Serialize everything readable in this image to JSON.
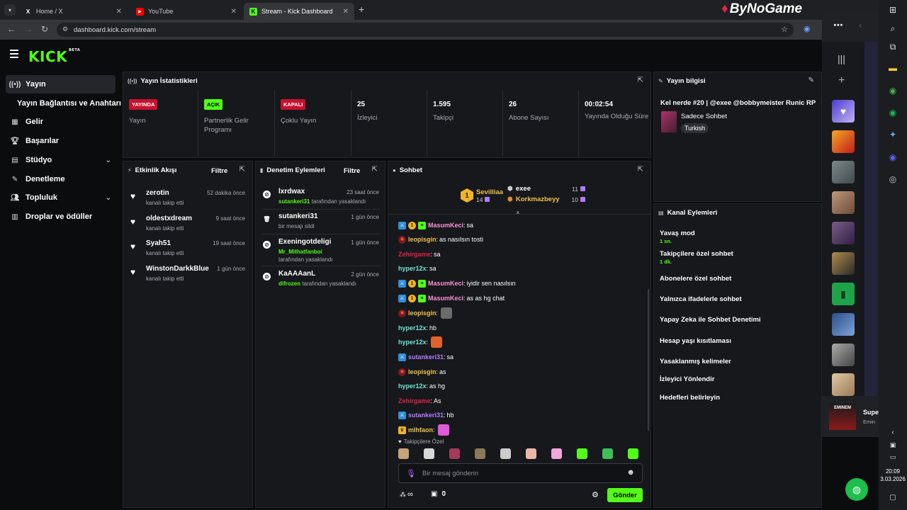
{
  "browser": {
    "tabs": [
      {
        "title": "Home / X",
        "icon": "x-logo-icon"
      },
      {
        "title": "YouTube",
        "icon": "youtube-icon"
      },
      {
        "title": "Stream - Kick Dashboard",
        "icon": "kick-icon"
      }
    ],
    "new_tab": "+",
    "url": "dashboard.kick.com/stream",
    "watermark": "ByNoGame"
  },
  "brand": {
    "logo": "KICK",
    "beta": "BETA"
  },
  "sidebar": {
    "items": [
      {
        "label": "Yayın",
        "icon": "broadcast-icon"
      },
      {
        "label": "Yayın Bağlantısı ve Anahtarı",
        "icon": ""
      },
      {
        "label": "Gelir",
        "icon": "revenue-icon"
      },
      {
        "label": "Başarılar",
        "icon": "trophy-icon"
      },
      {
        "label": "Stüdyo",
        "icon": "studio-icon"
      },
      {
        "label": "Denetleme",
        "icon": "wrench-icon"
      },
      {
        "label": "Topluluk",
        "icon": "community-icon"
      },
      {
        "label": "Droplar ve ödüller",
        "icon": "drops-icon"
      }
    ]
  },
  "stats": {
    "title": "Yayın İstatistikleri",
    "items": [
      {
        "badge": "YAYINDA",
        "label": "Yayın"
      },
      {
        "badge": "AÇIK",
        "label": "Partnerlik Gelir Programı"
      },
      {
        "badge": "KAPALI",
        "label": "Çoklu Yayın"
      },
      {
        "value": "25",
        "label": "İzleyici"
      },
      {
        "value": "1.595",
        "label": "Takipçi"
      },
      {
        "value": "26",
        "label": "Abone Sayısı"
      },
      {
        "value": "00:02:54",
        "label": "Yayında Olduğu Süre"
      }
    ]
  },
  "stream_info": {
    "title": "Yayın bilgisi",
    "stream_title": "Kel nerde #20 | @exee @bobbymeister Runic RP",
    "category": "Sadece Sohbet",
    "language": "Turkish"
  },
  "activity": {
    "title": "Etkinlik Akışı",
    "filter": "Filtre",
    "items": [
      {
        "name": "zerotin",
        "text": "kanalı takip etti",
        "time": "52 dakika önce"
      },
      {
        "name": "oldestxdream",
        "text": "kanalı takip etti",
        "time": "9 saat önce"
      },
      {
        "name": "Syah51",
        "text": "kanalı takip etti",
        "time": "19 saat önce"
      },
      {
        "name": "WinstonDarkkBlue",
        "text": "kanalı takip etti",
        "time": "1 gün önce"
      }
    ]
  },
  "moderation": {
    "title": "Denetim Eylemleri",
    "filter": "Filtre",
    "items": [
      {
        "name": "lxrdwax",
        "by": "sutankeri31",
        "text": "tarafından yasaklandı",
        "time": "23 saat önce",
        "icon": "ban-icon"
      },
      {
        "name": "sutankeri31",
        "by": "",
        "text": "bir mesajı sildi",
        "time": "1 gün önce",
        "icon": "trash-icon"
      },
      {
        "name": "Exeningotdeligi",
        "by": "Mr_Mithatfanboi",
        "text": "tarafından yasaklandı",
        "time": "1 gün önce",
        "icon": "ban-icon"
      },
      {
        "name": "KaAAAanL",
        "by": "difrozen",
        "text": "tarafından yasaklandı",
        "time": "2 gün önce",
        "icon": "ban-icon"
      }
    ]
  },
  "chat": {
    "title": "Sohbet",
    "top": [
      {
        "name": "Sevilliaa",
        "count": "14",
        "rank": "1"
      },
      {
        "name": "exee",
        "count": "11"
      },
      {
        "name": "Korkmazbeyy",
        "count": "10"
      }
    ],
    "messages": [
      {
        "user": "MasumKeci",
        "color": "#ff8fd8",
        "text": "sa",
        "badges": [
          "mod",
          "1",
          "sub"
        ]
      },
      {
        "user": "leopisgin",
        "color": "#f0c24a",
        "text": "as nasılsın tosti",
        "badges": [
          "og"
        ]
      },
      {
        "user": "Zehirgame",
        "color": "#e0224b",
        "text": "sa",
        "badges": []
      },
      {
        "user": "hyper12x",
        "color": "#6ee7d6",
        "text": "sa",
        "badges": []
      },
      {
        "user": "MasumKeci",
        "color": "#ff8fd8",
        "text": "iyidir sen nasılsın",
        "badges": [
          "mod",
          "1",
          "sub"
        ]
      },
      {
        "user": "MasumKeci",
        "color": "#ff8fd8",
        "text": "as as hg chat",
        "badges": [
          "mod",
          "1",
          "sub"
        ]
      },
      {
        "user": "leopisgin",
        "color": "#f0c24a",
        "text": "",
        "badges": [
          "og"
        ],
        "emote": true
      },
      {
        "user": "hyper12x",
        "color": "#6ee7d6",
        "text": "hb",
        "badges": []
      },
      {
        "user": "hyper12x",
        "color": "#6ee7d6",
        "text": "",
        "badges": [],
        "emote": true
      },
      {
        "user": "sutankeri31",
        "color": "#b57bff",
        "text": "sa",
        "badges": [
          "mod"
        ]
      },
      {
        "user": "leopisgin",
        "color": "#f0c24a",
        "text": "as",
        "badges": [
          "og"
        ]
      },
      {
        "user": "hyper12x",
        "color": "#6ee7d6",
        "text": "as hg",
        "badges": []
      },
      {
        "user": "Zehirgame",
        "color": "#e0224b",
        "text": "As",
        "badges": []
      },
      {
        "user": "sutankeri31",
        "color": "#b57bff",
        "text": "hb",
        "badges": [
          "mod"
        ]
      },
      {
        "user": "mlhfaon",
        "color": "#f0c24a",
        "text": "",
        "badges": [
          "crown"
        ],
        "emote": true
      }
    ],
    "followers_only": "Takipçilere Özel",
    "placeholder": "Bir mesaj gönderin",
    "infinity": "∞",
    "gift_count": "0",
    "send": "Gönder"
  },
  "channel_actions": {
    "title": "Kanal Eylemleri",
    "items": [
      {
        "label": "Yavaş mod",
        "sub": "1 sn."
      },
      {
        "label": "Takipçilere özel sohbet",
        "sub": "1 dk."
      },
      {
        "label": "Abonelere özel sohbet",
        "sub": ""
      },
      {
        "label": "Yalnızca ifadelerle sohbet",
        "sub": ""
      },
      {
        "label": "Yapay Zeka ile Sohbet Denetimi",
        "sub": ""
      },
      {
        "label": "Hesap yaşı kısıtlaması",
        "sub": ""
      },
      {
        "label": "Yasaklanmış kelimeler",
        "sub": ""
      },
      {
        "label": "İzleyici Yönlendir",
        "sub": ""
      },
      {
        "label": "Hedefleri belirleyin",
        "sub": ""
      }
    ]
  },
  "media": {
    "title": "Supe",
    "artist": "Emin",
    "album": "EMINEM"
  },
  "clock": {
    "time": "20:09",
    "date": "3.03.2026"
  },
  "colors": {
    "accent": "#53fc18",
    "live": "#e0224b"
  }
}
